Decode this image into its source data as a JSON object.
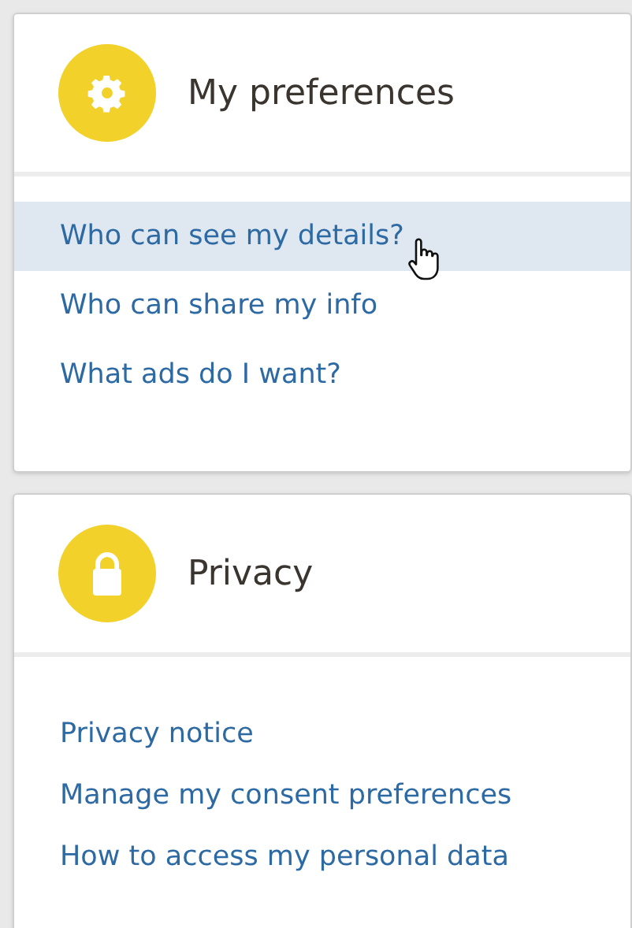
{
  "sections": [
    {
      "title": "My preferences",
      "kind": "gear",
      "links": [
        {
          "label": "Who can see my details?",
          "hovered": true
        },
        {
          "label": "Who can share my info",
          "hovered": false
        },
        {
          "label": "What ads do I want?",
          "hovered": false
        }
      ]
    },
    {
      "title": "Privacy",
      "kind": "lock",
      "links": [
        {
          "label": "Privacy notice",
          "hovered": false
        },
        {
          "label": "Manage my consent preferences",
          "hovered": false
        },
        {
          "label": "How to access my personal data",
          "hovered": false
        }
      ]
    }
  ]
}
